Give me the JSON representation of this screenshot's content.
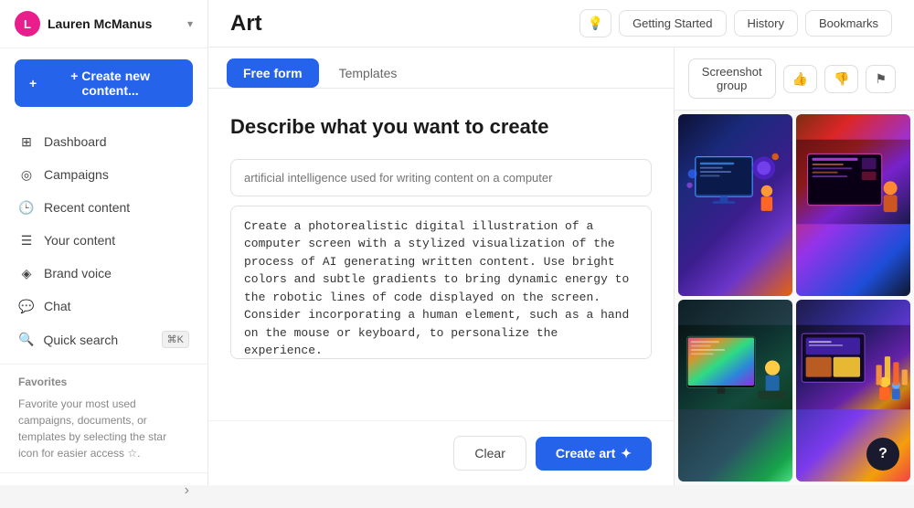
{
  "sidebar": {
    "user": {
      "name": "Lauren McManus",
      "initials": "L"
    },
    "create_button": "+ Create new content...",
    "nav_items": [
      {
        "id": "dashboard",
        "label": "Dashboard",
        "icon": "⊞"
      },
      {
        "id": "campaigns",
        "label": "Campaigns",
        "icon": "◎"
      },
      {
        "id": "recent-content",
        "label": "Recent content",
        "icon": "🕒"
      },
      {
        "id": "your-content",
        "label": "Your content",
        "icon": "☰"
      },
      {
        "id": "brand-voice",
        "label": "Brand voice",
        "icon": "◈"
      },
      {
        "id": "chat",
        "label": "Chat",
        "icon": "💬"
      }
    ],
    "quick_search": {
      "label": "Quick search",
      "shortcut": "⌘K"
    },
    "favorites": {
      "title": "Favorites",
      "description": "Favorite your most used campaigns, documents, or templates by selecting the star icon for easier access ☆."
    },
    "collapse_icon": "›"
  },
  "topbar": {
    "title": "Art",
    "actions": {
      "bulb_icon": "💡",
      "getting_started": "Getting Started",
      "history": "History",
      "bookmarks": "Bookmarks"
    }
  },
  "tabs": {
    "free_form": "Free form",
    "templates": "Templates"
  },
  "form": {
    "heading": "Describe what you want to create",
    "placeholder": "artificial intelligence used for writing content on a computer",
    "prompt_text": "Create a photorealistic digital illustration of a computer screen with a stylized visualization of the process of AI generating written content. Use bright colors and subtle gradients to bring dynamic energy to the robotic lines of code displayed on the screen. Consider incorporating a human element, such as a hand on the mouse or keyboard, to personalize the experience.",
    "clear_label": "Clear",
    "create_art_label": "Create art",
    "create_art_icon": "✦"
  },
  "right_panel": {
    "screenshot_group_label": "Screenshot group",
    "thumbs_up_icon": "👍",
    "thumbs_down_icon": "👎",
    "flag_icon": "🏁"
  },
  "help": {
    "label": "?"
  }
}
